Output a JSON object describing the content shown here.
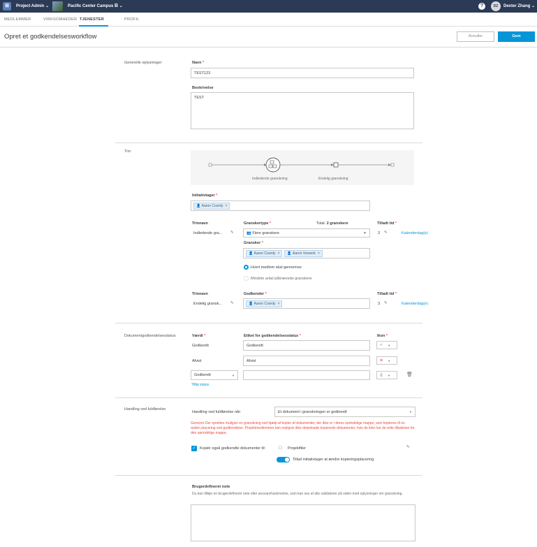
{
  "topbar": {
    "app_title": "Project Admin",
    "project_name": "Pacific Center Campus",
    "project_badge": "B",
    "help": "?",
    "avatar_initials": "DZ",
    "user_name": "Dexter Zhang"
  },
  "tabs": [
    "MEDLEMMER",
    "VIRKSOMHEDER",
    "TJENESTER",
    "PROFIL"
  ],
  "active_tab": "TJENESTER",
  "page": {
    "title": "Opret et godkendelsesworkflow",
    "cancel": "Annuller",
    "save": "Gem"
  },
  "general": {
    "section": "Generelle oplysninger",
    "name_label": "Navn",
    "name_value": "TEST123",
    "desc_label": "Beskrivelse",
    "desc_value": "TEST"
  },
  "steps": {
    "section": "Trin",
    "node1": "Indledende granskning",
    "node2": "Endelig granskning",
    "initiator_label": "Initiativtager",
    "initiator_chip": "Aaron Coordy",
    "step_name_label": "Trinnavn",
    "reviewer_type_label": "Granskertype",
    "total_label": "Total:",
    "total_value": "2 granskere",
    "allowed_time_label": "Tilladt tid",
    "step1_name": "Indledende gra...",
    "reviewer_type_value": "Flere granskere",
    "reviewers_label": "Gransker",
    "reviewer_chip1": "Aaron Coordy",
    "reviewer_chip2": "Aaron Verwerk",
    "radio1": "Hvert medlem skal gennemse",
    "radio2": "Mindste antal påkrævede granskere",
    "step1_days": "3",
    "days_unit": "Kalenderdag(e)",
    "step2_name_label": "Trinnavn",
    "approver_label": "Godkender",
    "allowed_time_label2": "Tilladt tid",
    "step2_name": "Endelig gransk...",
    "approver_chip": "Aaron Coordy",
    "step2_days": "3",
    "days_unit2": "Kalenderdag(e)"
  },
  "status": {
    "section": "Dokumentgodkendelsesstatus",
    "value_label": "Værdi",
    "label_label": "Etiket for godkendelsesstatus",
    "icon_label": "Ikon",
    "rows": [
      {
        "value": "Godkendt",
        "label": "Godkendt",
        "icon_color": "#6eb84a"
      },
      {
        "value": "Afvist",
        "label": "Afvist",
        "icon_color": "#ec4a41"
      },
      {
        "value": "Godkendt",
        "label": "",
        "icon_color": "#8a8a8a"
      }
    ],
    "add_link": "Tilføj status"
  },
  "completion": {
    "section": "Handling ved fuldførelse",
    "when_label": "Handling ved fuldførelse når:",
    "when_value": "Et dokument i granskningen er godkendt",
    "error_text": "Genereri Der oprettes muligvis en granskning ved hjælp af kopier af dokumenter, der ikke er i deres oprindelige mappe, som kopieres til en anden placering ved godkendelse. Projektmedlemmer kan muligvis ikke downloade kopierede dokumenter, hvis de ikke har de rette tilladelser for den oprindelige mappe.",
    "copy_label": "Kopiér også godkendte dokumenter til:",
    "folder_name": "Projektfiler",
    "toggle_label": "Tillad initiativtager at ændre kopieringsplacering"
  },
  "note": {
    "title": "Brugerdefineret note",
    "desc": "Du kan tilføje en brugerdefineret note eller ansvarsfraskrivelse, som kan ses af alle validatorer på siden med oplysninger om granskning."
  },
  "colors": {
    "accent": "#0696d7",
    "topbar": "#2b3a55",
    "error": "#ec4a41"
  }
}
